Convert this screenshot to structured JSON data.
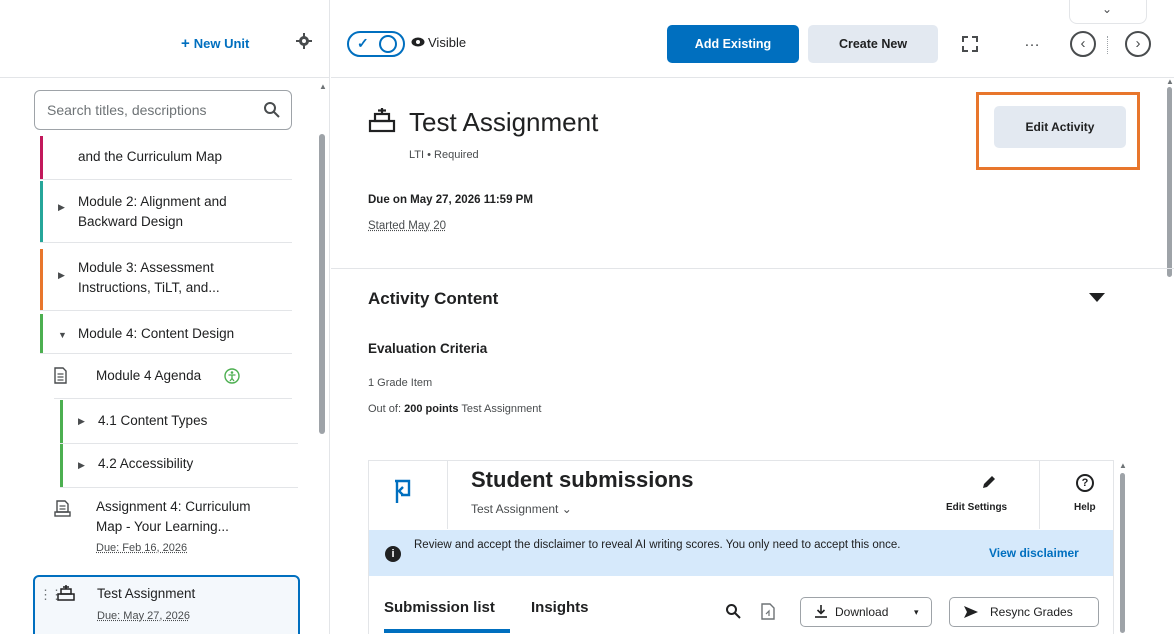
{
  "left_header": {
    "new_unit_label": "New Unit",
    "new_unit_icon": "+"
  },
  "search": {
    "placeholder": "Search titles, descriptions"
  },
  "tree": {
    "module1_tail": "and the Curriculum Map",
    "module2": "Module 2: Alignment and Backward Design",
    "module2_line1": "Module 2: Alignment and",
    "module2_line2": "Backward Design",
    "module3_line1": "Module 3: Assessment",
    "module3_line2": "Instructions, TiLT, and...",
    "module4": "Module 4: Content Design",
    "agenda": "Module 4 Agenda",
    "sub41": "4.1 Content Types",
    "sub42": "4.2 Accessibility",
    "assign4_line1": "Assignment 4: Curriculum",
    "assign4_line2": "Map - Your Learning...",
    "assign4_due": "Due: Feb 16, 2026",
    "test_title": "Test Assignment",
    "test_due": "Due: May 27, 2026"
  },
  "colors": {
    "module1": "#c2185b",
    "module2": "#26a69a",
    "module3": "#e8762c",
    "module4": "#4caf50",
    "sub": "#4caf50",
    "accent": "#006fbf",
    "highlight": "#e8762c"
  },
  "topbar": {
    "visible_label": "Visible",
    "add_existing": "Add Existing",
    "create_new": "Create New",
    "more": "…",
    "prev": "‹",
    "next": "›",
    "collapse": "⌄"
  },
  "main": {
    "title": "Test Assignment",
    "meta": "LTI  •  Required",
    "edit_activity": "Edit Activity",
    "due": "Due on May 27, 2026 11:59 PM",
    "started": "Started May 20",
    "activity_content": "Activity Content",
    "evaluation_criteria": "Evaluation Criteria",
    "grade_item": "1 Grade Item",
    "out_of_prefix": "Out of:",
    "out_of_points": "200 points",
    "out_of_name": "Test Assignment"
  },
  "panel": {
    "title": "Student submissions",
    "subtitle": "Test Assignment",
    "subtitle_caret": "⌄",
    "edit_settings": "Edit Settings",
    "help": "Help",
    "help_glyph": "?",
    "banner_info": "i",
    "banner_msg": "Review and accept the disclaimer to reveal AI writing scores. You only need to accept this once.",
    "banner_link": "View disclaimer",
    "tab_submission": "Submission list",
    "tab_insights": "Insights",
    "download": "Download",
    "download_caret": "▾",
    "resync": "Resync Grades"
  }
}
